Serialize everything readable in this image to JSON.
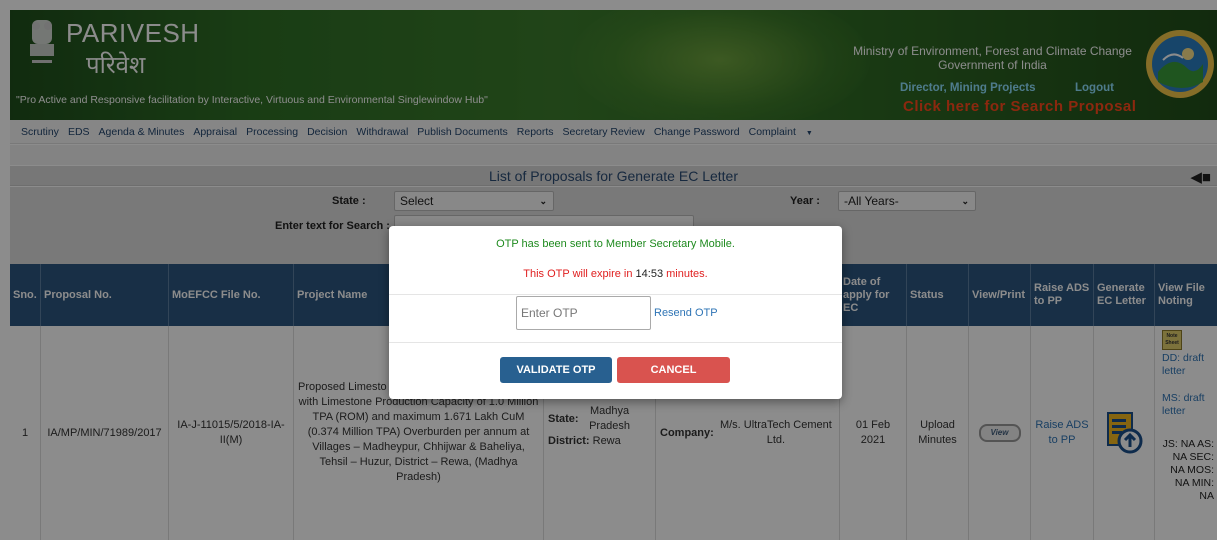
{
  "header": {
    "brand_en": "PARIVESH",
    "brand_hi": "परिवेश",
    "tagline": "\"Pro Active and Responsive facilitation by Interactive, Virtuous and Environmental Singlewindow Hub\"",
    "ministry_line1": "Ministry of Environment, Forest and Climate Change",
    "ministry_line2": "Government of India",
    "user_role": "Director, Mining Projects",
    "logout": "Logout",
    "search_proposal": "Click here for Search Proposal"
  },
  "nav": {
    "items": [
      "Scrutiny",
      "EDS",
      "Agenda & Minutes",
      "Appraisal",
      "Processing",
      "Decision",
      "Withdrawal",
      "Publish Documents",
      "Reports",
      "Secretary Review",
      "Change Password",
      "Complaint"
    ]
  },
  "panel": {
    "title": "List of Proposals for Generate EC Letter",
    "state_label": "State :",
    "state_value": "Select",
    "year_label": "Year :",
    "year_value": "-All Years-",
    "search_label": "Enter text for Search :"
  },
  "table": {
    "headers": [
      "Sno.",
      "Proposal No.",
      "MoEFCC File No.",
      "Project Name",
      "",
      "",
      "Date of apply for EC",
      "Status",
      "View/Print",
      "Raise ADS to PP",
      "Generate EC Letter",
      "View File Noting"
    ],
    "row": {
      "sno": "1",
      "proposal_no": "IA/MP/MIN/71989/2017",
      "file_no": "IA-J-11015/5/2018-IA-II(M)",
      "project_name": "Proposed Limestone ... with Limestone Production Capacity of 1.0 Million TPA (ROM) and maximum 1.671 Lakh CuM (0.374 Million TPA) Overburden per annum at Villages – Madheypur, Chhijwar & Baheliya, Tehsil – Huzur, District – Rewa, (Madhya Pradesh)",
      "project_name_visible": "Proposed Limesto",
      "project_name_rest": "with Limestone Production Capacity of 1.0 Million TPA (ROM) and maximum 1.671 Lakh CuM (0.374 Million TPA) Overburden per annum at Villages – Madheypur, Chhijwar & Baheliya, Tehsil – Huzur, District – Rewa, (Madhya Pradesh)",
      "state_label": "State:",
      "state_value": "Madhya Pradesh",
      "district_label": "District:",
      "district_value": "Rewa",
      "company_label": "Company:",
      "company_value": "M/s. UltraTech Cement Ltd.",
      "date": "01 Feb 2021",
      "status": "Upload Minutes",
      "view_label": "View",
      "raise_ads": "Raise ADS to PP",
      "noting_note": "Note Sheet",
      "noting_dd": "DD: draft letter",
      "noting_ms": "MS: draft letter",
      "noting_js": "JS: NA AS: NA SEC: NA MOS: NA MIN: NA"
    }
  },
  "modal": {
    "otp_sent": "OTP has been sent to Member Secretary Mobile.",
    "otp_expire_prefix": "This OTP will expire in",
    "otp_time": "14:53",
    "otp_expire_suffix": "minutes.",
    "otp_placeholder": "Enter OTP",
    "resend": "Resend OTP",
    "validate": "VALIDATE OTP",
    "cancel": "CANCEL"
  },
  "colors": {
    "header_green": "#2f6f26",
    "table_header": "#2c5680",
    "validate_btn": "#286090",
    "cancel_btn": "#d9534f",
    "otp_sent_text": "#1e8a1e",
    "otp_expire_text": "#e02020"
  }
}
